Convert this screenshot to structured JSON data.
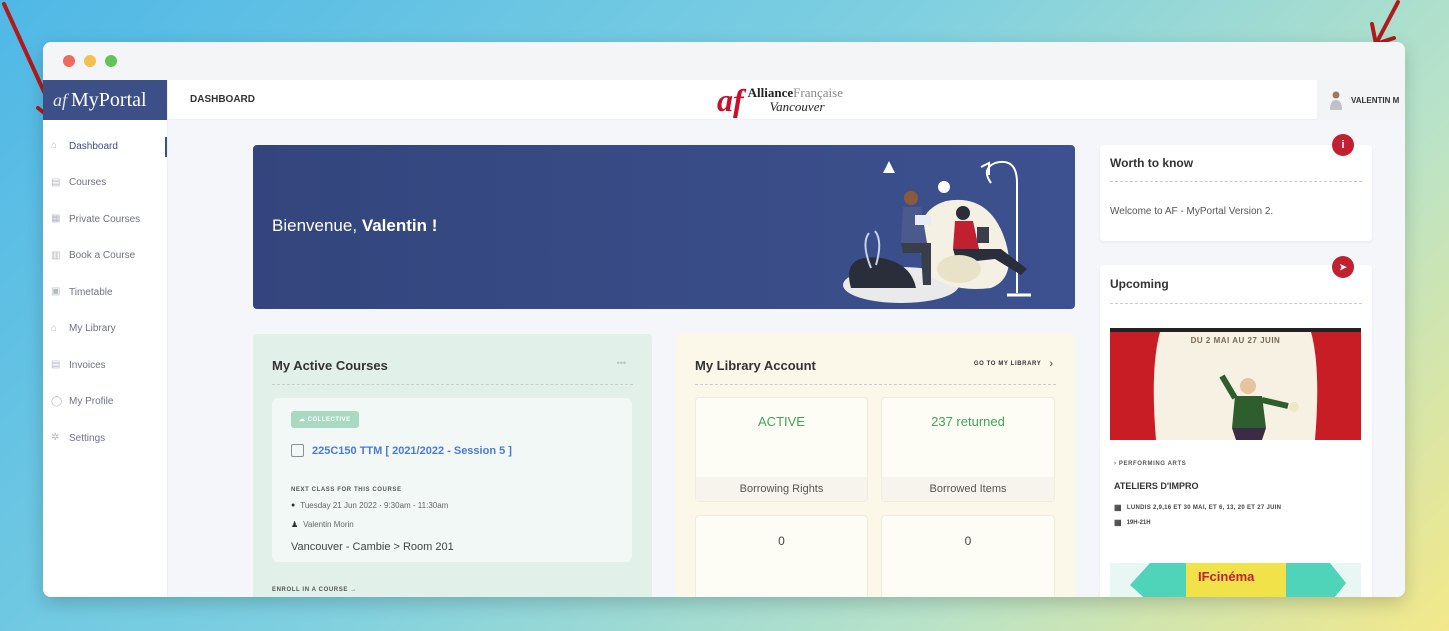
{
  "colors": {
    "brand": "#3c4f86",
    "accent_red": "#c0202f",
    "link": "#4a7bd0",
    "status_green": "#3ea65a"
  },
  "sidebar": {
    "brand_mark": "af",
    "brand_name": "MyPortal",
    "items": [
      {
        "label": "Dashboard",
        "icon": "home-icon"
      },
      {
        "label": "Courses",
        "icon": "courses-icon"
      },
      {
        "label": "Private Courses",
        "icon": "private-courses-icon"
      },
      {
        "label": "Book a Course",
        "icon": "book-course-icon"
      },
      {
        "label": "Timetable",
        "icon": "timetable-icon"
      },
      {
        "label": "My Library",
        "icon": "library-icon"
      },
      {
        "label": "Invoices",
        "icon": "invoice-icon"
      },
      {
        "label": "My Profile",
        "icon": "profile-icon"
      },
      {
        "label": "Settings",
        "icon": "gear-icon"
      }
    ]
  },
  "header": {
    "breadcrumb": "DASHBOARD",
    "logo_mark": "af",
    "logo_alliance": "Alliance",
    "logo_francaise": "Française",
    "logo_city": "Vancouver",
    "user_name": "VALENTIN M"
  },
  "banner": {
    "greeting": "Bienvenue,",
    "user": "Valentin !"
  },
  "courses_card": {
    "title": "My Active Courses",
    "menu": "•••",
    "tag": "COLLECTIVE",
    "course_name": "225C150 TTM [ 2021/2022 - Session 5 ]",
    "next_class_label": "NEXT CLASS FOR THIS COURSE",
    "next_class_time": "Tuesday 21 Jun 2022 · 9:30am - 11:30am",
    "teacher": "Valentin Morin",
    "location": "Vancouver - Cambie > Room 201",
    "enroll_link": "ENROLL IN A COURSE →"
  },
  "library_card": {
    "title": "My Library Account",
    "go_link": "GO TO MY LIBRARY",
    "status_value": "ACTIVE",
    "status_label": "Borrowing Rights",
    "returned_value": "237 returned",
    "returned_label": "Borrowed Items",
    "value_3": "0",
    "value_4": "0"
  },
  "worth_card": {
    "title": "Worth to know",
    "badge": "i",
    "text": "Welcome to AF - MyPortal Version 2."
  },
  "upcoming_card": {
    "title": "Upcoming",
    "badge": "➤",
    "image_caption": "DU 2 MAI AU 27 JUIN",
    "category": "› PERFORMING ARTS",
    "event_title": "ATELIERS D'IMPRO",
    "dates": "LUNDIS 2,9,16 ET 30 MAI, ET 6, 13, 20 ET 27 JUIN",
    "hours": "19H-21H",
    "next_logo": "IFcinéma"
  }
}
